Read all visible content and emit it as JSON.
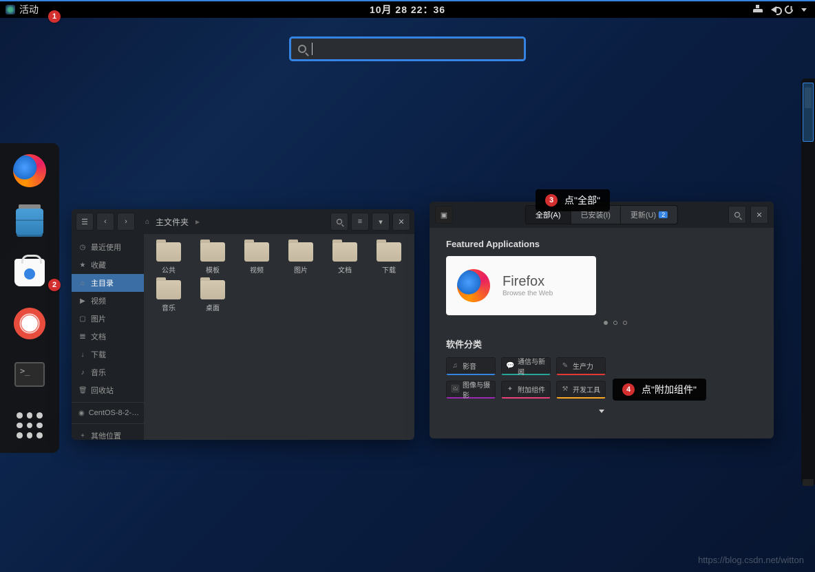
{
  "topbar": {
    "activities": "活动",
    "clock": "10月 28 22：36"
  },
  "search": {
    "placeholder": ""
  },
  "annotations": {
    "a1": "1",
    "a2": "2",
    "a3_num": "3",
    "a3_text": "点\"全部\"",
    "a4_num": "4",
    "a4_text": "点\"附加组件\""
  },
  "fm": {
    "path_home": "主文件夹",
    "sidebar": {
      "recent": "最近使用",
      "starred": "收藏",
      "home": "主目录",
      "videos": "视频",
      "pictures": "图片",
      "documents": "文档",
      "downloads": "下载",
      "music": "音乐",
      "trash": "回收站",
      "disk": "CentOS-8-2-…",
      "other": "其他位置"
    },
    "folders": {
      "public": "公共",
      "templates": "模板",
      "videos": "视频",
      "pictures": "图片",
      "documents": "文档",
      "downloads": "下载",
      "music": "音乐",
      "desktop": "桌面"
    }
  },
  "sw": {
    "tabs": {
      "all": "全部(A)",
      "installed": "已安装(I)",
      "updates": "更新(U)",
      "updates_count": "2"
    },
    "featured_title": "Featured Applications",
    "featured_app": {
      "name": "Firefox",
      "tagline": "Browse the Web"
    },
    "categories_title": "软件分类",
    "cats": {
      "av": "影音",
      "comm": "通信与新闻",
      "prod": "生产力",
      "graphics": "图像与摄影",
      "addons": "附加组件",
      "dev": "开发工具"
    }
  },
  "watermark": "https://blog.csdn.net/witton"
}
